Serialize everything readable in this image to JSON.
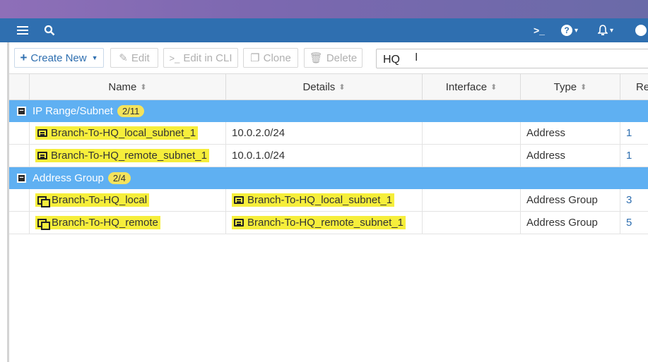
{
  "topbar": {
    "menu_icon": "hamburger-icon",
    "search_icon": "search-icon",
    "cli_icon": ">_",
    "help_icon": "?",
    "caret": "▾",
    "bell_icon": "bell-icon"
  },
  "toolbar": {
    "create_new": "Create New",
    "edit": "Edit",
    "edit_in_cli": "Edit in CLI",
    "clone": "Clone",
    "delete": "Delete"
  },
  "search": {
    "value": "HQ"
  },
  "table": {
    "columns": [
      "Name",
      "Details",
      "Interface",
      "Type",
      "Re"
    ],
    "groups": [
      {
        "name": "IP Range/Subnet",
        "count": "2/11",
        "rows": [
          {
            "name": "Branch-To-HQ_local_subnet_1",
            "details": "10.0.2.0/24",
            "interface": "",
            "type": "Address",
            "ref": "1"
          },
          {
            "name": "Branch-To-HQ_remote_subnet_1",
            "details": "10.0.1.0/24",
            "interface": "",
            "type": "Address",
            "ref": "1"
          }
        ]
      },
      {
        "name": "Address Group",
        "count": "2/4",
        "rows": [
          {
            "name": "Branch-To-HQ_local",
            "details": "Branch-To-HQ_local_subnet_1",
            "interface": "",
            "type": "Address Group",
            "ref": "3"
          },
          {
            "name": "Branch-To-HQ_remote",
            "details": "Branch-To-HQ_remote_subnet_1",
            "interface": "",
            "type": "Address Group",
            "ref": "5"
          }
        ]
      }
    ]
  },
  "colors": {
    "topbar": "#2f6fb0",
    "group_header": "#5fb0f2",
    "highlight": "#f6ee3b",
    "link": "#2f6fb0"
  }
}
